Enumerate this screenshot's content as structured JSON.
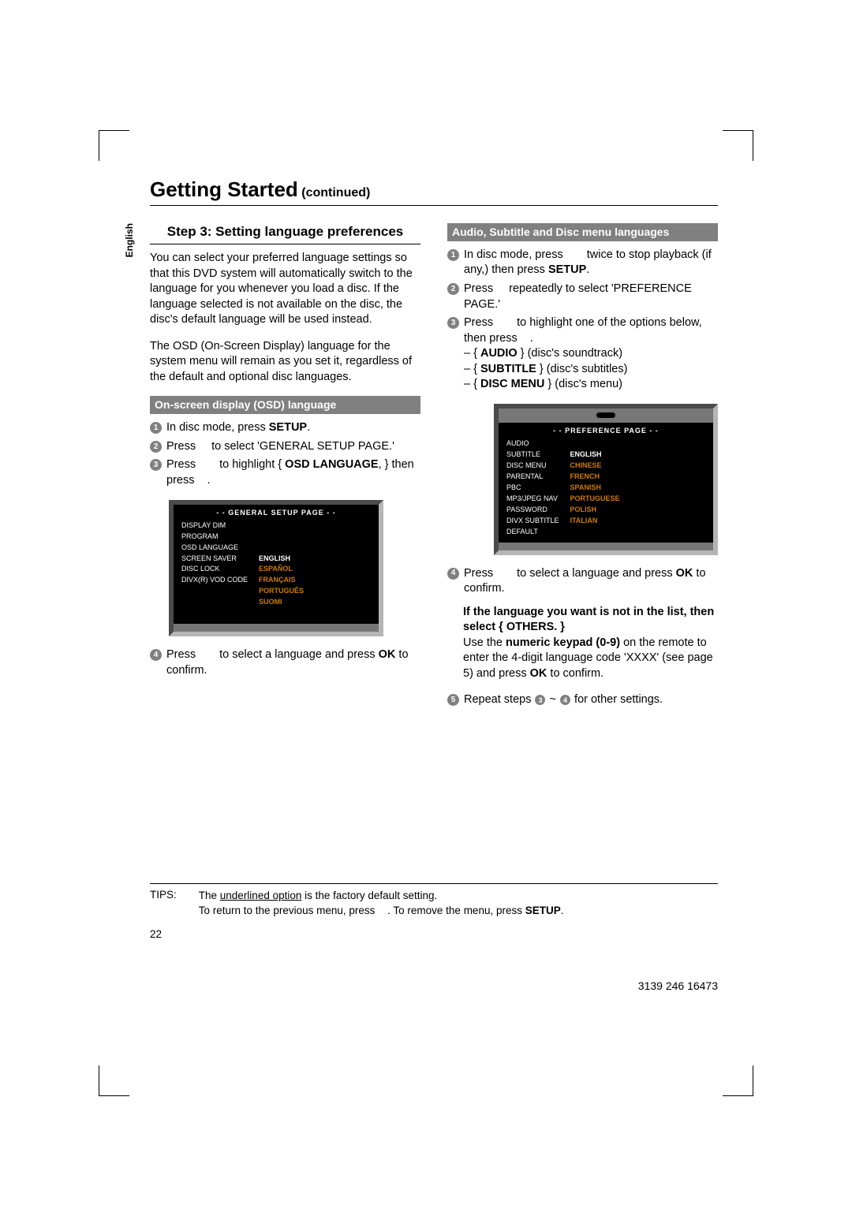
{
  "title": "Getting Started",
  "title_cont": "(continued)",
  "lang_tab": "English",
  "left": {
    "step_heading": "Step 3: Setting language preferences",
    "p1": "You can select your preferred language settings so that this DVD system will automatically switch to the language for you whenever you load a disc. If the language selected is not available on the disc, the disc's default language will be used instead.",
    "p2": "The OSD (On-Screen Display) language for the system menu will remain as you set it, regardless of the default and optional disc languages.",
    "bar": "On-screen display (OSD) language",
    "s1_a": "In disc mode, press ",
    "s1_b": "SETUP",
    "s1_c": ".",
    "s2_a": "Press ",
    "s2_b": " to select 'GENERAL SETUP PAGE.'",
    "s3_a": "Press ",
    "s3_b": " to highlight { ",
    "s3_c": "OSD LANGUAGE",
    "s3_d": ", } then press ",
    "s3_e": ".",
    "osd_head": "- -   GENERAL  SETUP  PAGE   - -",
    "osd_left": "DISPLAY DIM\nPROGRAM\nOSD LANGUAGE\nSCREEN SAVER\nDISC LOCK\nDIVX(R) VOD CODE",
    "osd_r0": "",
    "osd_r1": "",
    "osd_r2": "ENGLISH",
    "osd_r3": "ESPAÑOL",
    "osd_r4": "FRANÇAIS",
    "osd_r5": "PORTUGUÊS",
    "osd_r6": "SUOMI",
    "s4_a": "Press ",
    "s4_b": " to select a language and press ",
    "s4_c": "OK",
    "s4_d": " to confirm."
  },
  "right": {
    "bar": "Audio, Subtitle and Disc menu languages",
    "s1_a": "In disc mode, press ",
    "s1_b": " twice to stop playback (if any,) then press ",
    "s1_c": "SETUP",
    "s1_d": ".",
    "s2_a": "Press ",
    "s2_b": " repeatedly to select 'PREFERENCE PAGE.'",
    "s3_a": "Press ",
    "s3_b": " to highlight one of the options below, then press ",
    "s3_c": ".",
    "opt1_a": "– { ",
    "opt1_b": "AUDIO",
    "opt1_c": " } (disc's soundtrack)",
    "opt2_a": "– { ",
    "opt2_b": "SUBTITLE",
    "opt2_c": " } (disc's subtitles)",
    "opt3_a": "– { ",
    "opt3_b": "DISC MENU",
    "opt3_c": " } (disc's menu)",
    "pref_head": "- -   PREFERENCE  PAGE   - -",
    "pref_left": "AUDIO\nSUBTITLE\nDISC MENU\nPARENTAL\nPBC\nMP3/JPEG NAV\nPASSWORD\nDIVX SUBTITLE\nDEFAULT",
    "pref_r0": "ENGLISH",
    "pref_r1": "CHINESE",
    "pref_r2": "FRENCH",
    "pref_r3": "SPANISH",
    "pref_r4": "PORTUGUESE",
    "pref_r5": "POLISH",
    "pref_r6": "ITALIAN",
    "s4_a": "Press ",
    "s4_b": " to select a language and press ",
    "s4_c": "OK",
    "s4_d": " to confirm.",
    "note_a": "If the language you want is not in the list, then select { OTHERS. }",
    "note_b": "Use the ",
    "note_c": "numeric keypad (0-9)",
    "note_d": " on the remote to enter the 4-digit language code 'XXXX' (see page 5) and press ",
    "note_e": "OK",
    "note_f": " to confirm.",
    "s5_a": "Repeat steps ",
    "s5_b": " ~ ",
    "s5_c": " for other settings."
  },
  "tips": {
    "label": "TIPS:",
    "line1a": "The ",
    "line1b": "underlined option",
    "line1c": " is the factory default setting.",
    "line2a": "To return to the previous menu, press ",
    "line2b": ". To remove the menu, press ",
    "line2c": "SETUP",
    "line2d": "."
  },
  "page_num": "22",
  "part_num": "3139 246 16473"
}
